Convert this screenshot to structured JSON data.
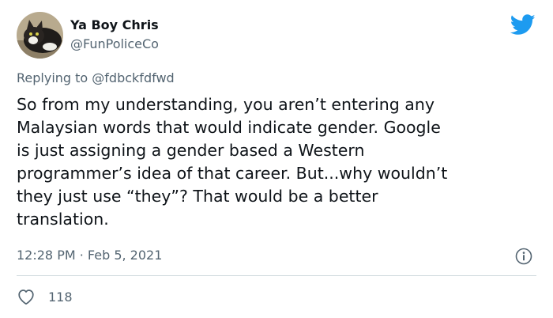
{
  "author": {
    "display_name": "Ya Boy Chris",
    "handle": "@FunPoliceCo",
    "avatar_icon": "cat-avatar-icon"
  },
  "brand": {
    "icon": "twitter-bird-icon",
    "color": "#1d9bf0"
  },
  "reply_context": {
    "prefix": "Replying to",
    "mention": "@fdbckfdfwd"
  },
  "tweet": {
    "lines": [
      "So from my understanding, you aren’t entering any",
      "Malaysian words that would indicate gender. Google",
      "is just assigning a gender based a Western",
      "programmer’s idea of that career. But...why wouldn’t",
      "they just use “they”? That would be a better",
      "translation."
    ],
    "timestamp": "12:28 PM · Feb 5, 2021"
  },
  "actions": {
    "like_icon": "heart-icon",
    "like_count": "118",
    "info_icon": "info-icon"
  },
  "colors": {
    "text_primary": "#0f1419",
    "text_secondary": "#536471",
    "divider": "#cfd9de"
  }
}
